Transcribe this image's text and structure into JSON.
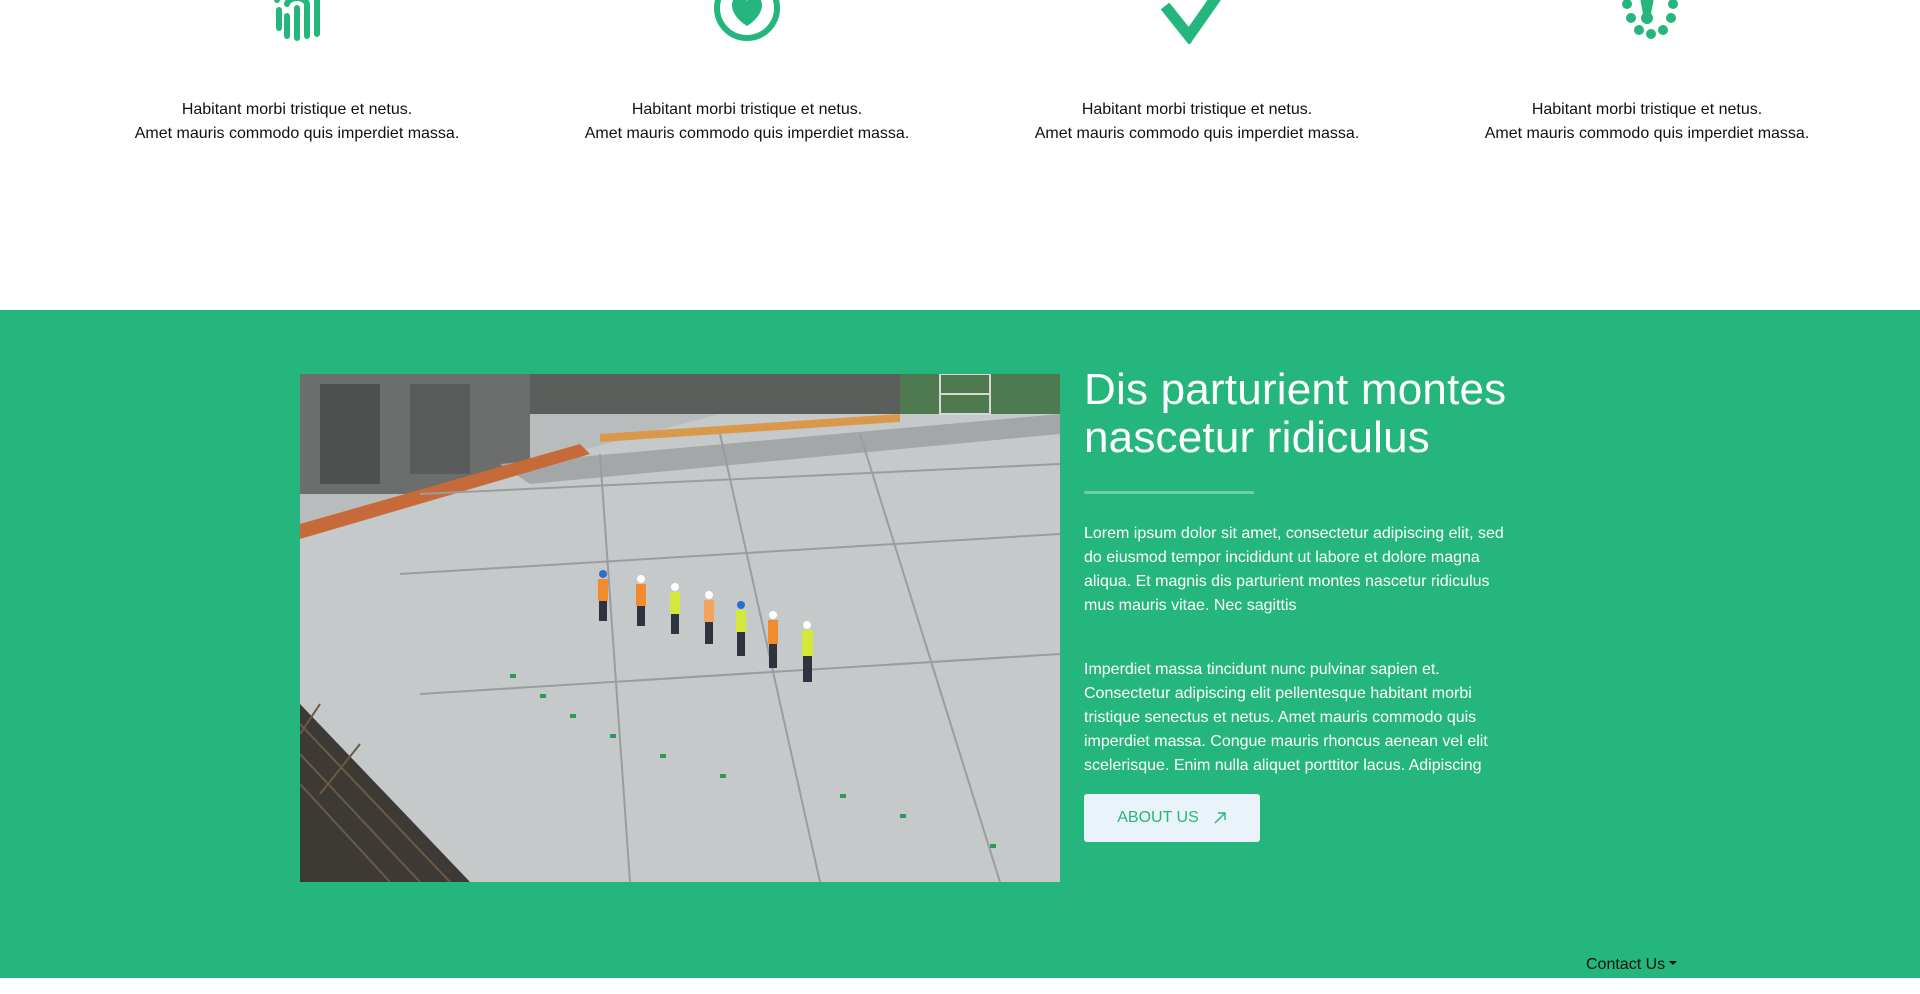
{
  "features": [
    {
      "icon": "fingerprint-icon",
      "line1": "Habitant morbi tristique et netus.",
      "line2": "Amet mauris commodo quis imperdiet massa."
    },
    {
      "icon": "heart-badge-icon",
      "line1": "Habitant morbi tristique et netus.",
      "line2": "Amet mauris commodo quis imperdiet massa."
    },
    {
      "icon": "checkmark-icon",
      "line1": "Habitant morbi tristique et netus.",
      "line2": "Amet mauris commodo quis imperdiet massa."
    },
    {
      "icon": "award-badge-icon",
      "line1": "Habitant morbi tristique et netus.",
      "line2": "Amet mauris commodo quis imperdiet massa."
    }
  ],
  "about": {
    "heading_line1": "Dis parturient montes",
    "heading_line2": "nascetur ridiculus",
    "paragraph1": "Lorem ipsum dolor sit amet, consectetur adipiscing elit, sed do eiusmod tempor incididunt ut labore et dolore magna aliqua. Et magnis dis parturient montes nascetur ridiculus mus mauris vitae. Nec sagittis",
    "paragraph2": "Imperdiet massa tincidunt nunc pulvinar sapien et. Consectetur adipiscing elit pellentesque habitant morbi tristique senectus et netus. Amet mauris commodo quis imperdiet massa. Congue mauris rhoncus aenean vel elit scelerisque. Enim nulla aliquet porttitor lacus. Adipiscing",
    "button_label": "ABOUT US",
    "button_icon": "arrow-up-right-icon"
  },
  "nav": {
    "contact_label": "Contact Us"
  },
  "colors": {
    "accent": "#24b67c",
    "button_bg": "#eaf3f9",
    "text_dark": "#111111",
    "white": "#ffffff"
  }
}
